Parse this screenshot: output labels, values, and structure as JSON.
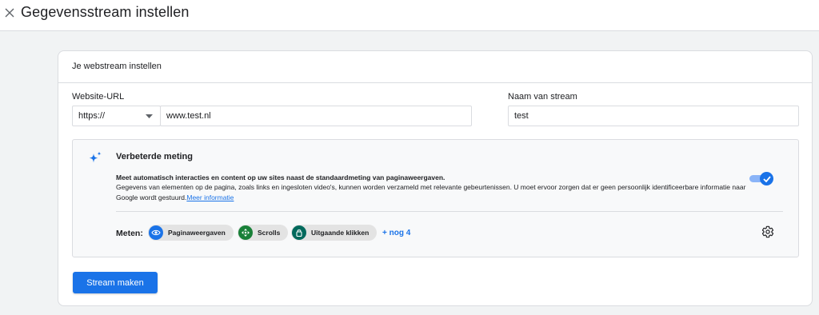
{
  "header": {
    "title": "Gegevensstream instellen",
    "close_icon": "close-icon"
  },
  "card": {
    "title": "Je webstream instellen",
    "website_url_label": "Website-URL",
    "protocol_value": "https://",
    "url_value": "www.test.nl",
    "stream_name_label": "Naam van stream",
    "stream_name_value": "test"
  },
  "enhanced": {
    "icon": "sparkle-icon",
    "title": "Verbeterde meting",
    "desc_bold": "Meet automatisch interacties en content op uw sites naast de standaardmeting van paginaweergaven.",
    "desc": "Gegevens van elementen op de pagina, zoals links en ingesloten video's, kunnen worden verzameld met relevante gebeurtenissen. U moet ervoor zorgen dat er geen persoonlijk identificeerbare informatie naar Google wordt gestuurd.",
    "learn_more": "Meer informatie",
    "toggle_on": true,
    "metrics_label": "Meten:",
    "chips": [
      {
        "label": "Paginaweergaven",
        "icon": "eye-icon",
        "color": "#1a73e8"
      },
      {
        "label": "Scrolls",
        "icon": "scroll-icon",
        "color": "#188038"
      },
      {
        "label": "Uitgaande klikken",
        "icon": "lock-icon",
        "color": "#00695c"
      }
    ],
    "more_link": "+ nog 4",
    "settings_icon": "gear-icon"
  },
  "actions": {
    "create_label": "Stream maken"
  },
  "colors": {
    "accent": "#1a73e8",
    "background": "#f1f3f4"
  }
}
